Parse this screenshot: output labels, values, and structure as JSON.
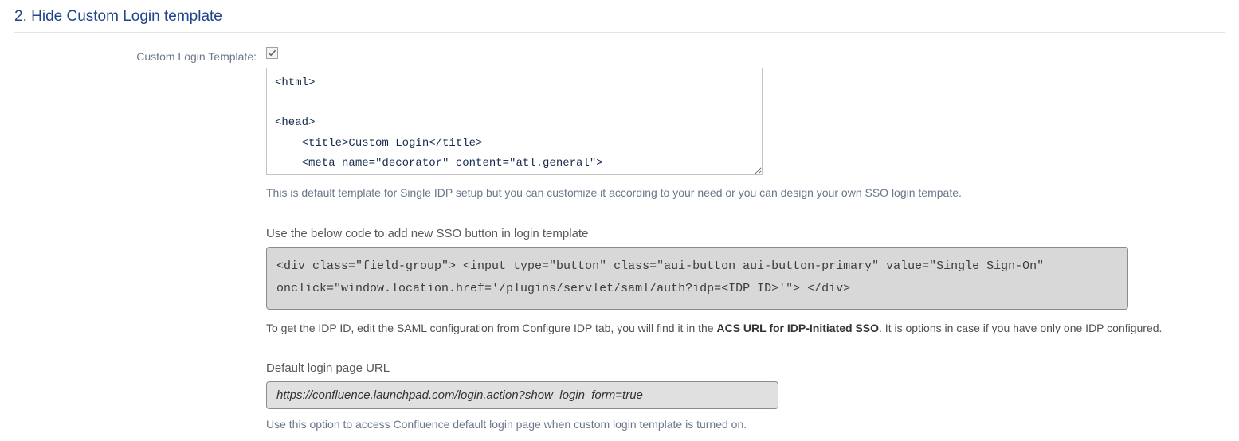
{
  "section": {
    "heading": "2. Hide Custom Login template"
  },
  "form": {
    "label": "Custom Login Template:",
    "checkbox_checked": true,
    "template_value": "<html>\n\n<head>\n    <title>Custom Login</title>\n    <meta name=\"decorator\" content=\"atl.general\">",
    "template_help": "This is default template for Single IDP setup but you can customize it according to your need or you can design your own SSO login tempate."
  },
  "sso_button": {
    "label": "Use the below code to add new SSO button in login template",
    "code": "<div class=\"field-group\"> <input type=\"button\" class=\"aui-button aui-button-primary\" value=\"Single Sign-On\" onclick=\"window.location.href='/plugins/servlet/saml/auth?idp=<IDP ID>'\"> </div>",
    "note_before": "To get the IDP ID, edit the SAML configuration from Configure IDP tab, you will find it in the ",
    "note_bold": "ACS URL for IDP-Initiated SSO",
    "note_after": ". It is options in case if you have only one IDP configured."
  },
  "default_url": {
    "label": "Default login page URL",
    "value": "https://confluence.launchpad.com/login.action?show_login_form=true",
    "help": "Use this option to access Confluence default login page when custom login template is turned on."
  }
}
